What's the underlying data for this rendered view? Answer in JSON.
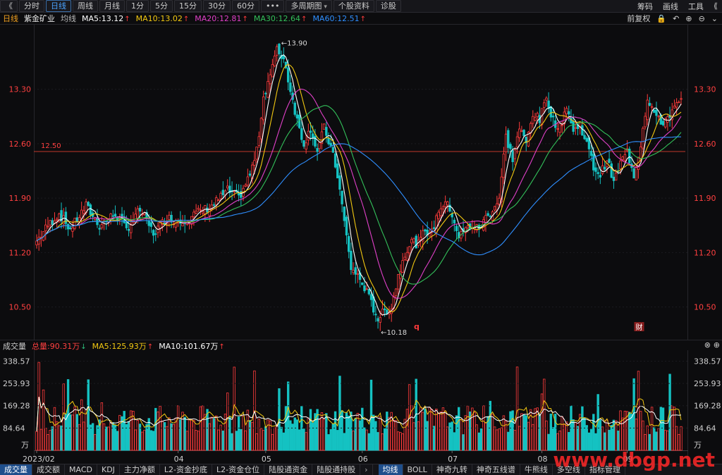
{
  "toolbar": {
    "back_icon": "double-chevron-left-icon",
    "tabs": [
      "分时",
      "日线",
      "周线",
      "月线",
      "1分",
      "5分",
      "15分",
      "30分",
      "60分",
      "•••",
      "多周期图",
      "个股资料",
      "诊股"
    ],
    "active_tab": "日线",
    "right_items": [
      "筹码",
      "画线",
      "工具"
    ]
  },
  "info": {
    "period": "日线",
    "stock_name": "紫金矿业",
    "ma_label": "均线",
    "ma5": "MA5:13.12",
    "ma10": "MA10:13.02",
    "ma20": "MA20:12.81",
    "ma30": "MA30:12.64",
    "ma60": "MA60:12.51",
    "adjust": "前复权"
  },
  "colors": {
    "ma5": "#ffffff",
    "ma10": "#f2c811",
    "ma20": "#e040c8",
    "ma30": "#33c05a",
    "ma60": "#2f8fff",
    "up": "#ff3b3b",
    "down": "#15c2c2",
    "axis_label": "#ff4040"
  },
  "price_axis": {
    "labels": [
      "13.30",
      "12.60",
      "11.90",
      "11.20",
      "10.50"
    ],
    "values": [
      13.3,
      12.6,
      11.9,
      11.2,
      10.5
    ],
    "range": [
      10.08,
      14.14
    ],
    "hline_value": 12.5,
    "hline_label": "12.50",
    "high_label": "13.90",
    "low_label": "10.18"
  },
  "markers": [
    "q",
    "财"
  ],
  "volume": {
    "label": "成交量",
    "total": "总量:90.31万",
    "ma5": "MA5:125.93万",
    "ma10": "MA10:101.67万",
    "axis_labels": [
      "338.57",
      "253.93",
      "169.28",
      "84.64"
    ],
    "axis_values": [
      338.57,
      253.93,
      169.28,
      84.64
    ],
    "unit": "万"
  },
  "x_axis": {
    "labels": [
      "2023/02",
      "04",
      "05",
      "06",
      "07",
      "08",
      "09"
    ]
  },
  "bottom_tabs": [
    "成交量",
    "成交额",
    "MACD",
    "KDJ",
    "主力净额",
    "L2-资金抄底",
    "L2-资金仓位",
    "陆股通资金",
    "陆股通持股",
    "均线",
    "BOLL",
    "神奇九转",
    "神奇五线谱",
    "牛熊线",
    "多空线",
    "指标管理"
  ],
  "bottom_active": [
    "成交量",
    "均线"
  ],
  "watermark": "www.dbgp.net",
  "chart_data": {
    "type": "candlestick",
    "title": "紫金矿业",
    "period": "日线",
    "ylim": [
      10.08,
      14.14
    ],
    "x_ticks": [
      "2023/02",
      "04",
      "05",
      "06",
      "07",
      "08",
      "09"
    ],
    "series": [
      {
        "name": "MA5",
        "last": 13.12
      },
      {
        "name": "MA10",
        "last": 13.02
      },
      {
        "name": "MA20",
        "last": 12.81
      },
      {
        "name": "MA30",
        "last": 12.64
      },
      {
        "name": "MA60",
        "last": 12.51
      }
    ],
    "price_path": [
      [
        0,
        11.35
      ],
      [
        5,
        11.55
      ],
      [
        10,
        11.7
      ],
      [
        15,
        11.5
      ],
      [
        22,
        11.8
      ],
      [
        28,
        11.55
      ],
      [
        35,
        11.7
      ],
      [
        40,
        11.5
      ],
      [
        46,
        11.75
      ],
      [
        52,
        11.45
      ],
      [
        58,
        11.65
      ],
      [
        64,
        11.6
      ],
      [
        72,
        11.72
      ],
      [
        78,
        11.8
      ],
      [
        85,
        12.0
      ],
      [
        90,
        11.9
      ],
      [
        95,
        12.2
      ],
      [
        98,
        12.5
      ],
      [
        101,
        13.2
      ],
      [
        104,
        13.5
      ],
      [
        107,
        13.8
      ],
      [
        110,
        13.7
      ],
      [
        113,
        13.3
      ],
      [
        116,
        12.9
      ],
      [
        119,
        12.6
      ],
      [
        122,
        12.8
      ],
      [
        125,
        12.5
      ],
      [
        128,
        12.8
      ],
      [
        131,
        12.55
      ],
      [
        134,
        12.2
      ],
      [
        137,
        11.6
      ],
      [
        140,
        11.0
      ],
      [
        143,
        10.9
      ],
      [
        146,
        10.75
      ],
      [
        149,
        10.55
      ],
      [
        152,
        10.35
      ],
      [
        155,
        10.45
      ],
      [
        158,
        10.5
      ],
      [
        161,
        10.9
      ],
      [
        164,
        11.2
      ],
      [
        167,
        11.35
      ],
      [
        170,
        11.3
      ],
      [
        173,
        11.5
      ],
      [
        176,
        11.45
      ],
      [
        179,
        11.75
      ],
      [
        182,
        11.85
      ],
      [
        185,
        11.7
      ],
      [
        188,
        11.4
      ],
      [
        191,
        11.5
      ],
      [
        194,
        11.55
      ],
      [
        197,
        11.5
      ],
      [
        200,
        11.65
      ],
      [
        203,
        11.75
      ],
      [
        206,
        11.9
      ],
      [
        209,
        12.7
      ],
      [
        212,
        12.4
      ],
      [
        215,
        12.8
      ],
      [
        218,
        12.6
      ],
      [
        221,
        13.0
      ],
      [
        224,
        12.9
      ],
      [
        227,
        13.2
      ],
      [
        230,
        12.9
      ],
      [
        233,
        12.8
      ],
      [
        236,
        13.1
      ],
      [
        239,
        12.75
      ],
      [
        242,
        12.85
      ],
      [
        245,
        12.6
      ],
      [
        248,
        12.3
      ],
      [
        251,
        12.2
      ],
      [
        254,
        12.4
      ],
      [
        257,
        12.1
      ],
      [
        260,
        12.35
      ],
      [
        263,
        12.5
      ],
      [
        266,
        12.2
      ],
      [
        269,
        12.6
      ],
      [
        272,
        13.2
      ],
      [
        275,
        13.0
      ],
      [
        278,
        12.85
      ],
      [
        281,
        12.95
      ],
      [
        284,
        13.05
      ],
      [
        287,
        13.15
      ]
    ],
    "x_count": 288,
    "volume_ylim": [
      0,
      380
    ],
    "volume_last": 90.31,
    "volume_ma5_last": 125.93,
    "volume_ma10_last": 101.67
  }
}
